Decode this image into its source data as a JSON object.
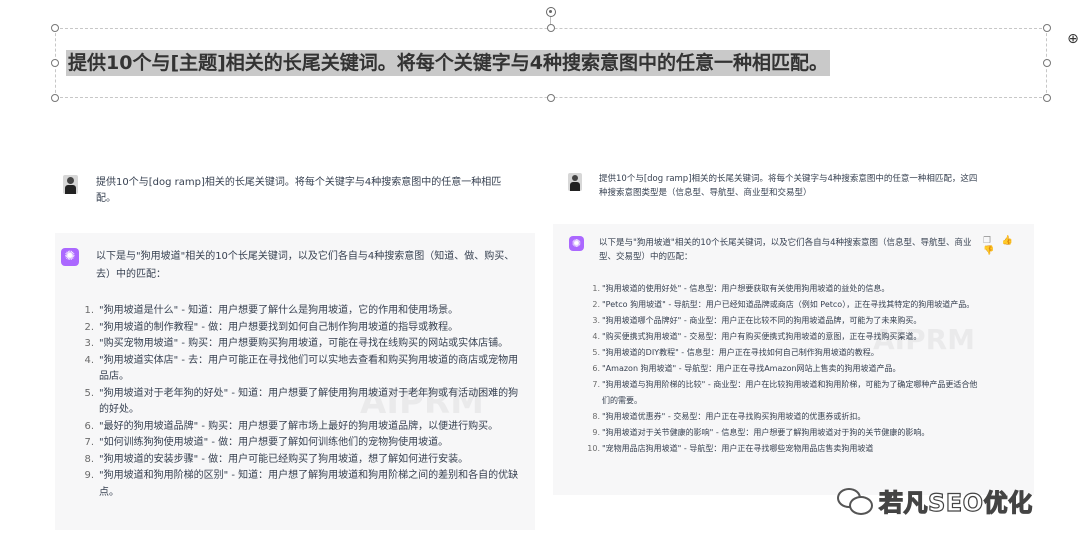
{
  "slide": {
    "title": "提供10个与[主题]相关的长尾关键词。将每个关键字与4种搜索意图中的任意一种相匹配。"
  },
  "left_panel": {
    "prompt": "提供10个与[dog ramp]相关的长尾关键词。将每个关键字与4种搜索意图中的任意一种相匹配。",
    "response_intro": "以下是与\"狗用坡道\"相关的10个长尾关键词，以及它们各自与4种搜索意图（知道、做、购买、去）中的匹配：",
    "items": [
      {
        "num": "1.",
        "text": "\"狗用坡道是什么\" - 知道：用户想要了解什么是狗用坡道，它的作用和使用场景。"
      },
      {
        "num": "2.",
        "text": "\"狗用坡道的制作教程\" - 做：用户想要找到如何自己制作狗用坡道的指导或教程。"
      },
      {
        "num": "3.",
        "text": "\"购买宠物用坡道\" - 购买：用户想要购买狗用坡道，可能在寻找在线购买的网站或实体店铺。"
      },
      {
        "num": "4.",
        "text": "\"狗用坡道实体店\" - 去：用户可能正在寻找他们可以实地去查看和购买狗用坡道的商店或宠物用品店。"
      },
      {
        "num": "5.",
        "text": "\"狗用坡道对于老年狗的好处\" - 知道：用户想要了解使用狗用坡道对于老年狗或有活动困难的狗的好处。"
      },
      {
        "num": "6.",
        "text": "\"最好的狗用坡道品牌\" - 购买：用户想要了解市场上最好的狗用坡道品牌，以便进行购买。"
      },
      {
        "num": "7.",
        "text": "\"如何训练狗狗使用坡道\" - 做：用户想要了解如何训练他们的宠物狗使用坡道。"
      },
      {
        "num": "8.",
        "text": "\"狗用坡道的安装步骤\" - 做：用户可能已经购买了狗用坡道，想了解如何进行安装。"
      },
      {
        "num": "9.",
        "text": "\"狗用坡道和狗用阶梯的区别\" - 知道：用户想了解狗用坡道和狗用阶梯之间的差别和各自的优缺点。"
      }
    ]
  },
  "right_panel": {
    "prompt": "提供10个与[dog ramp]相关的长尾关键词。将每个关键字与4种搜索意图中的任意一种相匹配，这四种搜索意图类型是（信息型、导航型、商业型和交易型）",
    "response_intro": "以下是与\"狗用坡道\"相关的10个长尾关键词，以及它们各自与4种搜索意图（信息型、导航型、商业型、交易型）中的匹配：",
    "actions": "❐ 👍 👎",
    "items": [
      {
        "num": "1.",
        "text": "\"狗用坡道的使用好处\" - 信息型：用户想要获取有关使用狗用坡道的益处的信息。"
      },
      {
        "num": "2.",
        "text": "\"Petco 狗用坡道\" - 导航型：用户已经知道品牌或商店（例如 Petco），正在寻找其特定的狗用坡道产品。"
      },
      {
        "num": "3.",
        "text": "\"狗用坡道哪个品牌好\" - 商业型：用户正在比较不同的狗用坡道品牌，可能为了未来购买。"
      },
      {
        "num": "4.",
        "text": "\"购买便携式狗用坡道\" - 交易型：用户有购买便携式狗用坡道的意图，正在寻找购买渠道。"
      },
      {
        "num": "5.",
        "text": "\"狗用坡道的DIY教程\" - 信息型：用户正在寻找如何自己制作狗用坡道的教程。"
      },
      {
        "num": "6.",
        "text": "\"Amazon 狗用坡道\" - 导航型：用户正在寻找Amazon网站上售卖的狗用坡道产品。"
      },
      {
        "num": "7.",
        "text": "\"狗用坡道与狗用阶梯的比较\" - 商业型：用户在比较狗用坡道和狗用阶梯，可能为了确定哪种产品更适合他们的需要。"
      },
      {
        "num": "8.",
        "text": "\"狗用坡道优惠券\" - 交易型：用户正在寻找购买狗用坡道的优惠券或折扣。"
      },
      {
        "num": "9.",
        "text": "\"狗用坡道对于关节健康的影响\" - 信息型：用户想要了解狗用坡道对于狗的关节健康的影响。"
      },
      {
        "num": "10.",
        "text": "\"宠物用品店狗用坡道\" - 导航型：用户正在寻找哪些宠物用品店售卖狗用坡道"
      }
    ]
  },
  "watermark": "AIPRM",
  "badge": {
    "text": "若凡SEO优化"
  }
}
